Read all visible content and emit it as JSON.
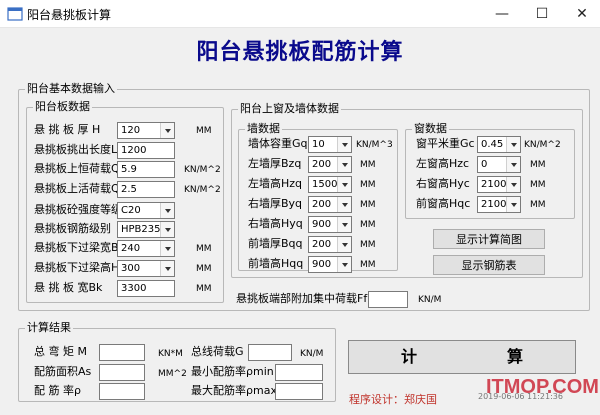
{
  "window": {
    "title": "阳台悬挑板计算",
    "minimize": "—",
    "maximize": "☐",
    "close": "✕"
  },
  "main_title": "阳台悬挑板配筋计算",
  "basic_group": {
    "legend": "阳台基本数据输入"
  },
  "slab": {
    "legend": "阳台板数据",
    "rows": [
      {
        "label": "悬 挑 板 厚 H",
        "value": "120",
        "unit": "MM",
        "type": "combo"
      },
      {
        "label": "悬挑板挑出长度L",
        "value": "1200",
        "unit": "",
        "type": "field"
      },
      {
        "label": "悬挑板上恒荷载Qg",
        "value": "5.9",
        "unit": "KN/M^2",
        "type": "field"
      },
      {
        "label": "悬挑板上活荷载Qp",
        "value": "2.5",
        "unit": "KN/M^2",
        "type": "field"
      },
      {
        "label": "悬挑板砼强度等级",
        "value": "C20",
        "unit": "",
        "type": "combo"
      },
      {
        "label": "悬挑板钢筋级别",
        "value": "HPB235",
        "unit": "",
        "type": "combo"
      },
      {
        "label": "悬挑板下过梁宽Bb",
        "value": "240",
        "unit": "MM",
        "type": "combo"
      },
      {
        "label": "悬挑板下过梁高Hb",
        "value": "300",
        "unit": "MM",
        "type": "combo"
      },
      {
        "label": "悬 挑 板 宽Bk",
        "value": "3300",
        "unit": "MM",
        "type": "field"
      }
    ]
  },
  "upper": {
    "legend": "阳台上窗及墙体数据"
  },
  "wall": {
    "legend": "墙数据",
    "rows": [
      {
        "label": "墙体容重Gq",
        "value": "10",
        "unit": "KN/M^3"
      },
      {
        "label": "左墙厚Bzq",
        "value": "200",
        "unit": "MM"
      },
      {
        "label": "左墙高Hzq",
        "value": "1500",
        "unit": "MM"
      },
      {
        "label": "右墙厚Byq",
        "value": "200",
        "unit": "MM"
      },
      {
        "label": "右墙高Hyq",
        "value": "900",
        "unit": "MM"
      },
      {
        "label": "前墙厚Bqq",
        "value": "200",
        "unit": "MM"
      },
      {
        "label": "前墙高Hqq",
        "value": "900",
        "unit": "MM"
      }
    ]
  },
  "window_data": {
    "legend": "窗数据",
    "rows": [
      {
        "label": "窗平米重Gc",
        "value": "0.45",
        "unit": "KN/M^2"
      },
      {
        "label": "左窗高Hzc",
        "value": "0",
        "unit": "MM"
      },
      {
        "label": "右窗高Hyc",
        "value": "2100",
        "unit": "MM"
      },
      {
        "label": "前窗高Hqc",
        "value": "2100",
        "unit": "MM"
      }
    ]
  },
  "buttons": {
    "diagram": "显示计算简图",
    "rebar_table": "显示钢筋表",
    "calculate_left": "计",
    "calculate_right": "算"
  },
  "tip_load": {
    "label": "悬挑板端部附加集中荷载Ff",
    "value": "",
    "unit": "KN/M"
  },
  "results": {
    "legend": "计算结果",
    "moment": {
      "label": "总 弯 矩 M",
      "value": "",
      "unit": "KN*M"
    },
    "total_load": {
      "label": "总线荷载G",
      "value": "",
      "unit": "KN/M"
    },
    "rebar_area": {
      "label": "配筋面积As",
      "value": "",
      "unit": "MM^2"
    },
    "min_ratio": {
      "label": "最小配筋率ρmin",
      "value": ""
    },
    "ratio": {
      "label": "配 筋 率ρ",
      "value": ""
    },
    "max_ratio": {
      "label": "最大配筋率ρmax",
      "value": ""
    }
  },
  "author": "程序设计：郑庆国",
  "timestamp": "2019-06-06 11:21:36",
  "watermark": "ITMOP.COM"
}
